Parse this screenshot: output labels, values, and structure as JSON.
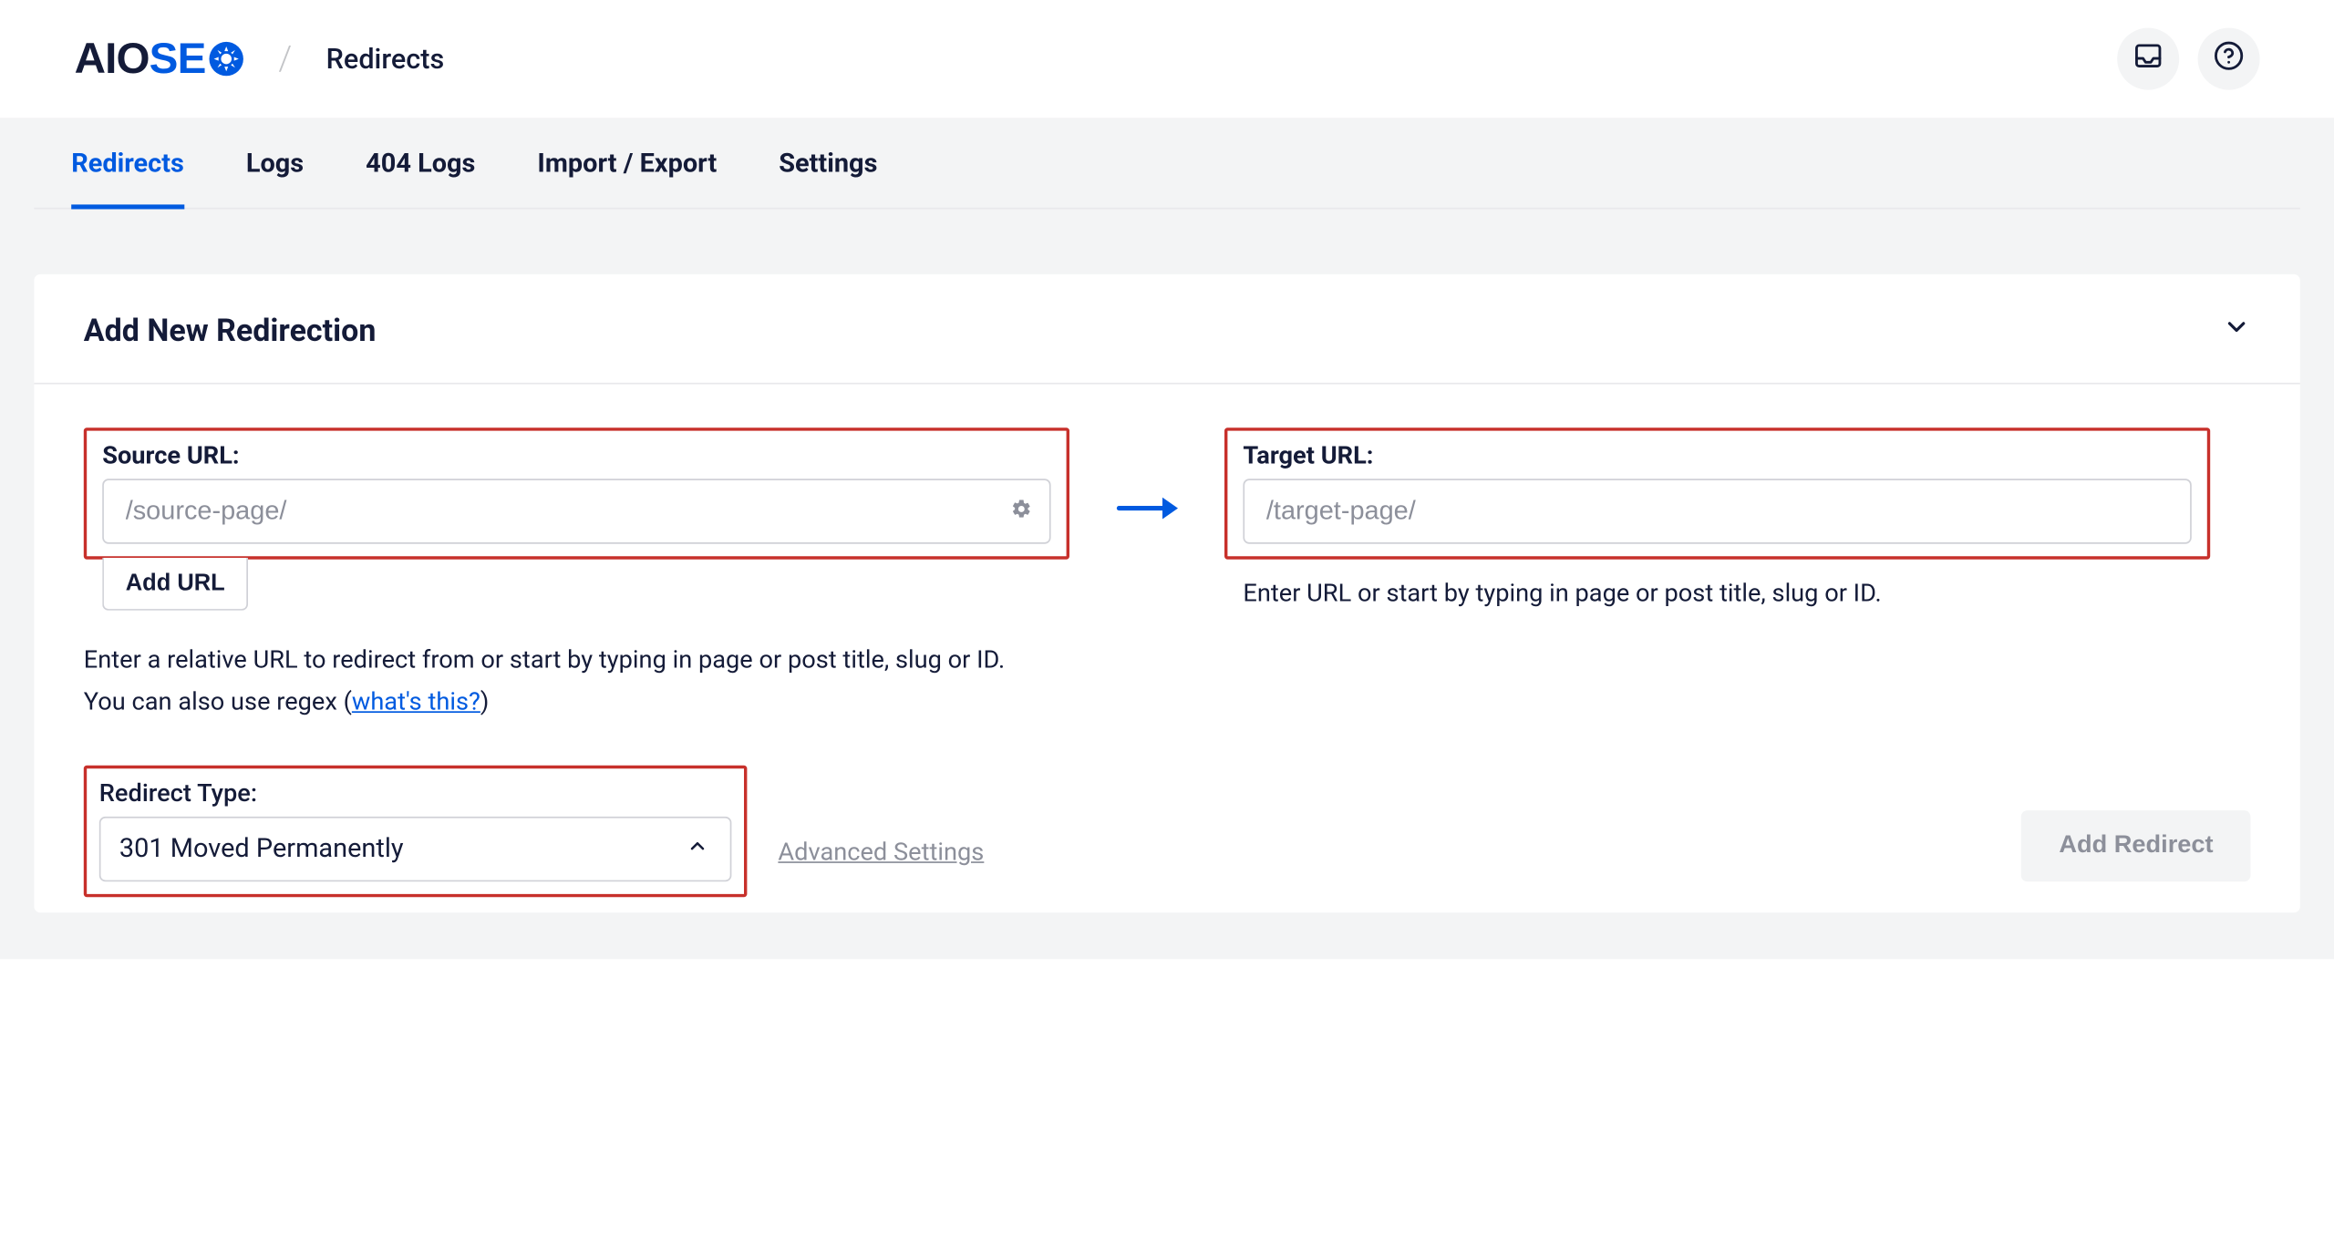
{
  "header": {
    "logo_text_aio": "AIO",
    "logo_text_se": "SE",
    "breadcrumb": "Redirects"
  },
  "tabs": [
    {
      "label": "Redirects",
      "active": true
    },
    {
      "label": "Logs",
      "active": false
    },
    {
      "label": "404 Logs",
      "active": false
    },
    {
      "label": "Import / Export",
      "active": false
    },
    {
      "label": "Settings",
      "active": false
    }
  ],
  "panel": {
    "title": "Add New Redirection",
    "source": {
      "label": "Source URL:",
      "placeholder": "/source-page/",
      "add_url_label": "Add URL",
      "helper_prefix": "Enter a relative URL to redirect from or start by typing in page or post title, slug or ID. You can also use regex (",
      "helper_link": "what's this?",
      "helper_suffix": ")"
    },
    "target": {
      "label": "Target URL:",
      "placeholder": "/target-page/",
      "helper": "Enter URL or start by typing in page or post title, slug or ID."
    },
    "redirect_type": {
      "label": "Redirect Type:",
      "selected": "301 Moved Permanently"
    },
    "advanced_settings_label": "Advanced Settings",
    "add_redirect_label": "Add Redirect"
  }
}
